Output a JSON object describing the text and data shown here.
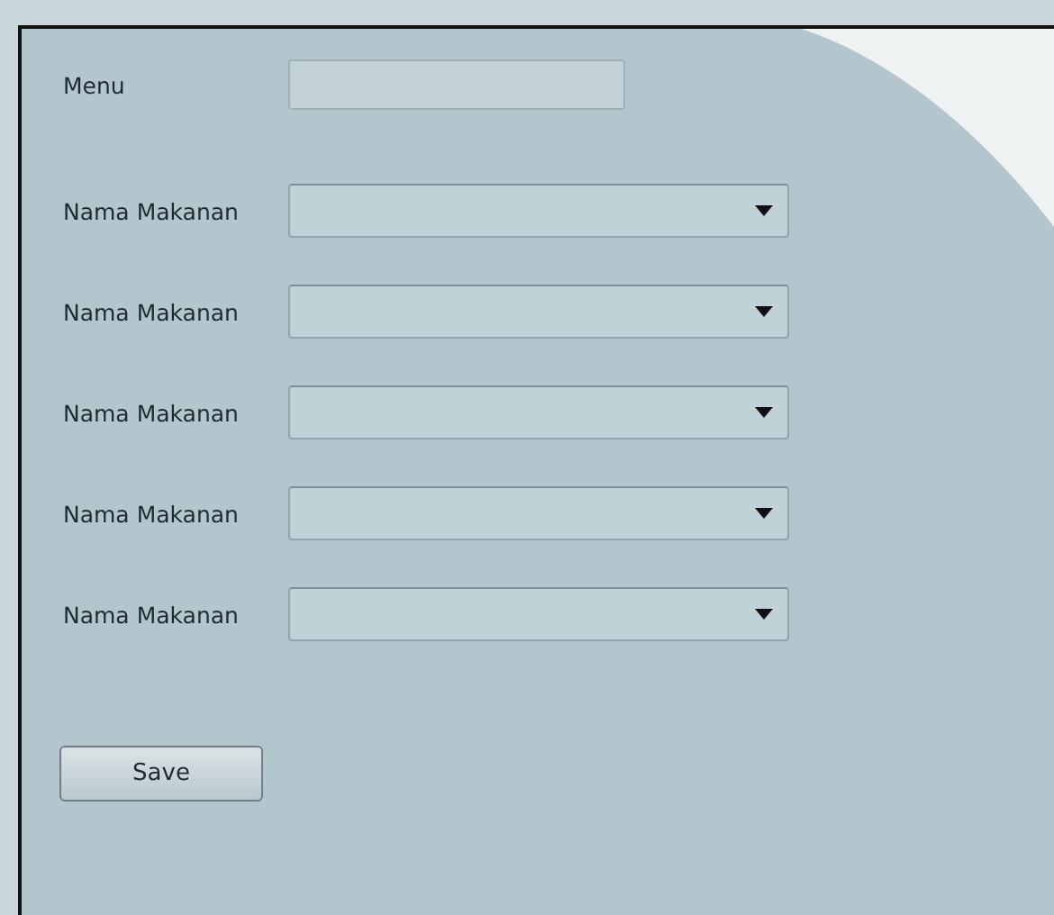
{
  "menu": {
    "label": "Menu"
  },
  "combos": [
    {
      "label": "Nama Makanan"
    },
    {
      "label": "Nama Makanan"
    },
    {
      "label": "Nama Makanan"
    },
    {
      "label": "Nama Makanan"
    },
    {
      "label": "Nama Makanan"
    }
  ],
  "buttons": [
    "Save"
  ]
}
